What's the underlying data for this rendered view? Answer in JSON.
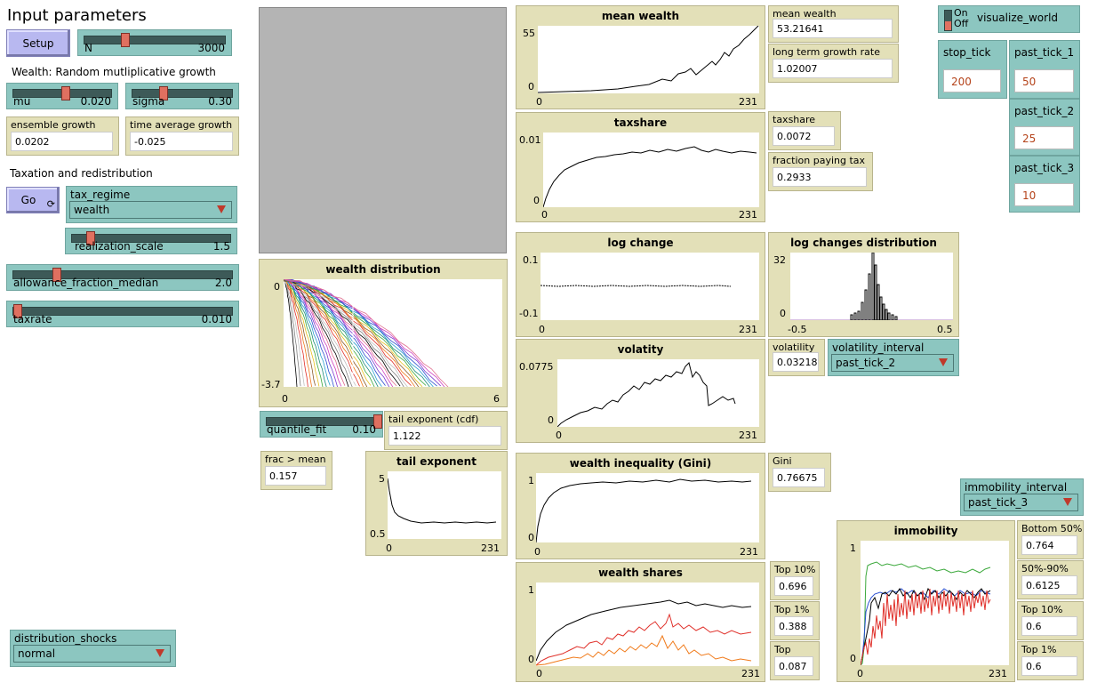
{
  "header": {
    "title": "Input parameters"
  },
  "setup": {
    "label": "Setup"
  },
  "go": {
    "label": "Go",
    "icon": "forever-icon"
  },
  "sections": {
    "wealth": "Wealth: Random mutliplicative growth",
    "tax": "Taxation and redistribution"
  },
  "sliders": {
    "N": {
      "name": "N",
      "value": "3000",
      "fraction": 0.3
    },
    "mu": {
      "name": "mu",
      "value": "0.020",
      "fraction": 0.5
    },
    "sigma": {
      "name": "sigma",
      "value": "0.30",
      "fraction": 0.3
    },
    "realization_scale": {
      "name": "realization_scale",
      "value": "1.5",
      "fraction": 0.15
    },
    "allowance": {
      "name": "allowance_fraction_median",
      "value": "2.0",
      "fraction": 0.2
    },
    "taxrate": {
      "name": "taxrate",
      "value": "0.010",
      "fraction": 0.02
    },
    "quantile_fit": {
      "name": "quantile_fit",
      "value": "0.10",
      "fraction": 1.0
    }
  },
  "monitors": {
    "ensemble_growth": {
      "label": "ensemble growth",
      "value": "0.0202"
    },
    "time_average_growth": {
      "label": "time average growth",
      "value": "-0.025"
    },
    "mean_wealth": {
      "label": "mean wealth",
      "value": "53.21641"
    },
    "long_term_growth": {
      "label": "long term growth rate",
      "value": "1.02007"
    },
    "taxshare": {
      "label": "taxshare",
      "value": "0.0072"
    },
    "fraction_paying_tax": {
      "label": "fraction paying tax",
      "value": "0.2933"
    },
    "volatility": {
      "label": "volatility",
      "value": "0.03218"
    },
    "tail_exponent_cdf": {
      "label": "tail exponent (cdf)",
      "value": "1.122"
    },
    "frac_gt_mean": {
      "label": "frac > mean",
      "value": "0.157"
    },
    "gini": {
      "label": "Gini",
      "value": "0.76675"
    },
    "top10": {
      "label": "Top 10%",
      "value": "0.696"
    },
    "top1": {
      "label": "Top 1%",
      "value": "0.388"
    },
    "top": {
      "label": "Top",
      "value": "0.087"
    },
    "bottom50": {
      "label": "Bottom 50%",
      "value": "0.764"
    },
    "mid50_90": {
      "label": "50%-90%",
      "value": "0.6125"
    },
    "imm_top10": {
      "label": "Top 10%",
      "value": "0.6"
    },
    "imm_top1": {
      "label": "Top 1%",
      "value": "0.6"
    }
  },
  "choosers": {
    "tax_regime": {
      "label": "tax_regime",
      "value": "wealth"
    },
    "volatility_interval": {
      "label": "volatility_interval",
      "value": "past_tick_2"
    },
    "immobility_interval": {
      "label": "immobility_interval",
      "value": "past_tick_3"
    },
    "distribution_shocks": {
      "label": "distribution_shocks",
      "value": "normal"
    }
  },
  "switch": {
    "on": "On",
    "off": "Off",
    "label": "visualize_world",
    "state": "off"
  },
  "inputs": {
    "stop_tick": {
      "label": "stop_tick",
      "value": "200"
    },
    "past_tick_1": {
      "label": "past_tick_1",
      "value": "50"
    },
    "past_tick_2": {
      "label": "past_tick_2",
      "value": "25"
    },
    "past_tick_3": {
      "label": "past_tick_3",
      "value": "10"
    }
  },
  "plots": {
    "mean_wealth": {
      "title": "mean wealth",
      "ymax": "55",
      "ymin": "0",
      "xmin": "0",
      "xmax": "231"
    },
    "taxshare": {
      "title": "taxshare",
      "ymax": "0.01",
      "ymin": "0",
      "xmin": "0",
      "xmax": "231"
    },
    "wealth_distribution": {
      "title": "wealth distribution",
      "ymax": "0",
      "ymin": "-3.7",
      "xmin": "0",
      "xmax": "6"
    },
    "log_change": {
      "title": "log change",
      "ymax": "0.1",
      "ymin": "-0.1",
      "xmin": "0",
      "xmax": "231"
    },
    "log_changes_distribution": {
      "title": "log changes distribution",
      "ymax": "32",
      "ymin": "0",
      "xmin": "-0.5",
      "xmax": "0.5"
    },
    "volatility": {
      "title": "volatity",
      "ymax": "0.0775",
      "ymin": "0",
      "xmin": "0",
      "xmax": "231"
    },
    "tail_exponent": {
      "title": "tail exponent",
      "ymax": "5",
      "ymin": "0.5",
      "xmin": "0",
      "xmax": "231"
    },
    "gini": {
      "title": "wealth inequality (Gini)",
      "ymax": "1",
      "ymin": "0",
      "xmin": "0",
      "xmax": "231"
    },
    "wealth_shares": {
      "title": "wealth shares",
      "ymax": "1",
      "ymin": "0",
      "xmin": "0",
      "xmax": "231"
    },
    "immobility": {
      "title": "immobility",
      "ymax": "1",
      "ymin": "0",
      "xmin": "0",
      "xmax": "231"
    }
  },
  "colors": {
    "button": "#b8b8f0",
    "widget": "#8cc6c0",
    "monitor": "#e3e0b8",
    "world": "#b4b4b4",
    "series_black": "#000000",
    "series_red": "#e0302a",
    "series_orange": "#f07a1a",
    "series_green": "#3aa83a",
    "series_blue": "#2a4fd0"
  }
}
